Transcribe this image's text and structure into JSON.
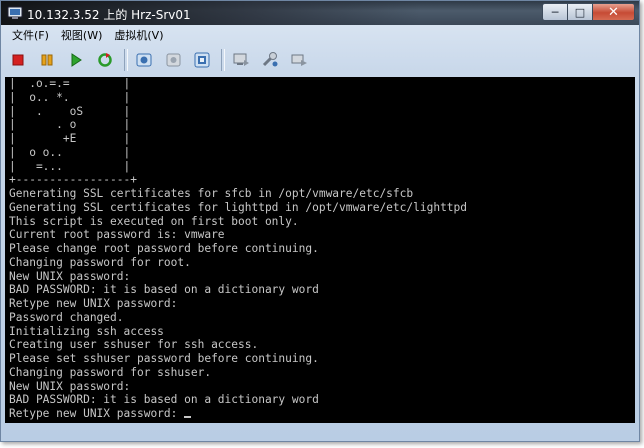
{
  "window": {
    "title": "10.132.3.52 上的 Hrz-Srv01",
    "controls": {
      "minimize": "─",
      "maximize": "□",
      "close": "✕"
    }
  },
  "menu": {
    "file": "文件(F)",
    "view": "视图(W)",
    "vm": "虚拟机(V)"
  },
  "toolbar": {
    "buttons": [
      "power-off",
      "suspend",
      "power-on",
      "reset",
      "snapshot",
      "revert-snapshot",
      "snapshot-manager",
      "console-view",
      "vm-settings",
      "full-screen"
    ],
    "colors": {
      "stop": "#d42020",
      "pause": "#e6a21a",
      "play": "#2ea32e",
      "reset": "#2a9a2a"
    }
  },
  "console": {
    "art": [
      "|  .o.=.=        |",
      "|  o.. *.        |",
      "|   .    oS      |",
      "|      . o       |",
      "|       +E       |",
      "|  o o..         |",
      "|   =...         |",
      "+-----------------+"
    ],
    "lines": [
      "Generating SSL certificates for sfcb in /opt/vmware/etc/sfcb",
      "Generating SSL certificates for lighttpd in /opt/vmware/etc/lighttpd",
      "This script is executed on first boot only.",
      "Current root password is: vmware",
      "Please change root password before continuing.",
      "Changing password for root.",
      "New UNIX password:",
      "BAD PASSWORD: it is based on a dictionary word",
      "Retype new UNIX password:",
      "Password changed.",
      "Initializing ssh access",
      "Creating user sshuser for ssh access.",
      "Please set sshuser password before continuing.",
      "Changing password for sshuser.",
      "New UNIX password:",
      "BAD PASSWORD: it is based on a dictionary word"
    ],
    "prompt": "Retype new UNIX password: ",
    "colors": {
      "background": "#000000",
      "foreground": "#c7c7c7"
    }
  }
}
